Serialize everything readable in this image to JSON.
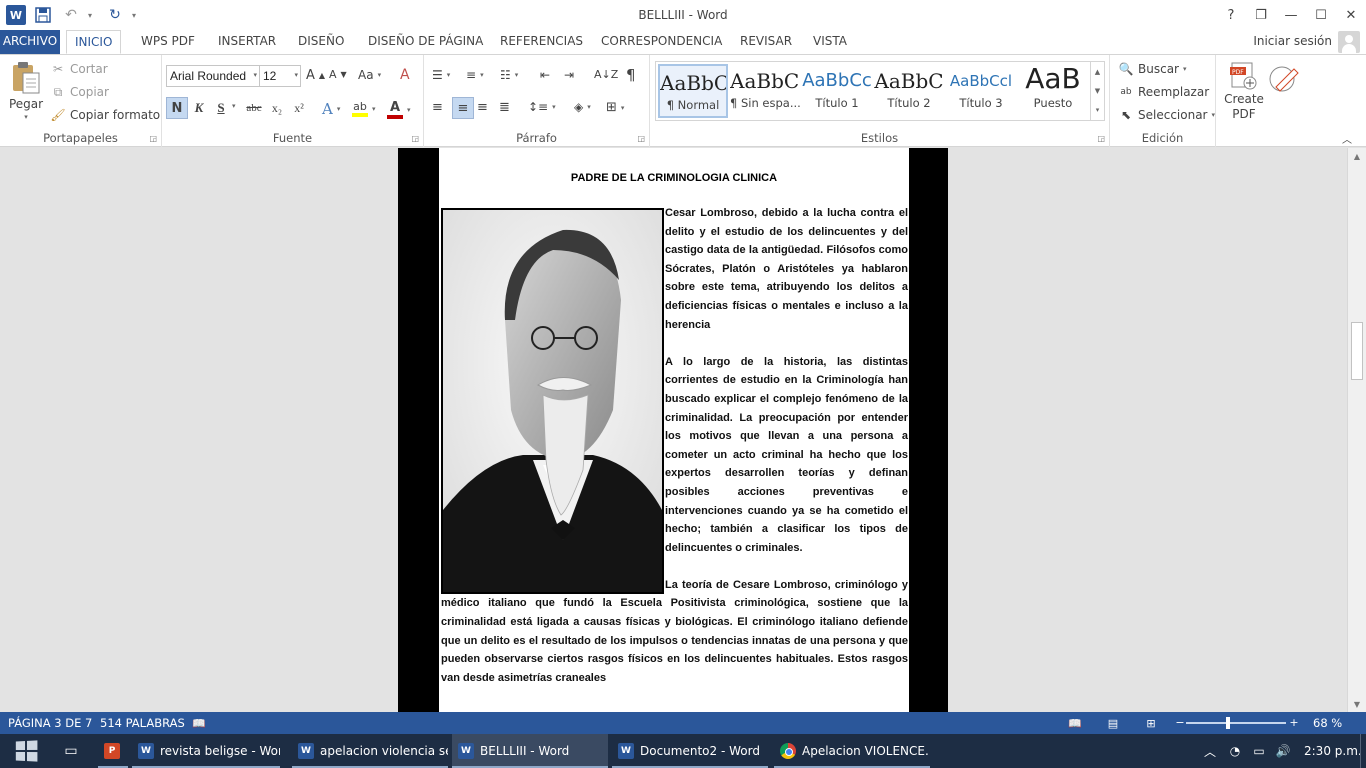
{
  "window": {
    "title": "BELLLIII - Word",
    "controls": [
      "?",
      "❐",
      "—",
      "☐",
      "✕"
    ]
  },
  "tabs": {
    "file": "ARCHIVO",
    "items": [
      "INICIO",
      "WPS PDF",
      "INSERTAR",
      "DISEÑO",
      "DISEÑO DE PÁGINA",
      "REFERENCIAS",
      "CORRESPONDENCIA",
      "REVISAR",
      "VISTA"
    ],
    "active": "INICIO",
    "signin": "Iniciar sesión"
  },
  "clipboard": {
    "paste": "Pegar",
    "cut": "Cortar",
    "copy": "Copiar",
    "format_painter": "Copiar formato",
    "label": "Portapapeles"
  },
  "font": {
    "family": "Arial Rounded",
    "size": "12",
    "bold": "N",
    "italic": "K",
    "underline": "S",
    "strike": "abc",
    "subscript": "x₂",
    "superscript": "x²",
    "label": "Fuente",
    "highlight_color": "#ffff00",
    "font_color": "#c00000"
  },
  "paragraph": {
    "label": "Párrafo"
  },
  "styles": {
    "items": [
      {
        "sample": "AaBbCcDc",
        "name": "¶ Normal"
      },
      {
        "sample": "AaBbCcDc",
        "name": "¶ Sin espa..."
      },
      {
        "sample": "AaBbCc",
        "name": "Título 1"
      },
      {
        "sample": "AaBbC",
        "name": "Título 2"
      },
      {
        "sample": "AaBbCcl",
        "name": "Título 3"
      },
      {
        "sample": "AaB",
        "name": "Puesto"
      }
    ],
    "label": "Estilos"
  },
  "editing": {
    "find": "Buscar",
    "replace": "Reemplazar",
    "select": "Seleccionar",
    "label": "Edición"
  },
  "pdf": {
    "create": "Create",
    "pdf": "PDF"
  },
  "document": {
    "heading": "PADRE DE LA CRIMINOLOGIA CLINICA",
    "paragraphs": [
      "Cesar Lombroso, debido a la lucha contra el delito y el estudio de los delincuentes y del castigo data de la antigüedad. Filósofos como Sócrates, Platón o Aristóteles ya hablaron sobre este tema, atribuyendo los delitos a deficiencias físicas o mentales e incluso a la herencia",
      "A lo largo de la historia, las distintas corrientes de estudio en la Criminología han buscado explicar el complejo fenómeno de la criminalidad. La preocupación por entender los motivos que llevan a una persona a cometer un acto criminal ha hecho que los expertos desarrollen teorías y definan posibles acciones preventivas e intervenciones cuando ya se ha cometido el hecho; también a clasificar los tipos de delincuentes o criminales.",
      "La teoría de Cesare Lombroso, criminólogo y médico italiano que fundó la Escuela Positivista criminológica, sostiene que la criminalidad está ligada a causas físicas y biológicas. El criminólogo italiano defiende que un delito es el resultado de los impulsos o tendencias innatas de una persona y que pueden observarse ciertos rasgos físicos en los delincuentes habituales. Estos rasgos van desde asimetrías craneales"
    ]
  },
  "status": {
    "page": "PÁGINA 3 DE 7",
    "words": "514 PALABRAS",
    "zoom": "68 %",
    "zoom_level": 0.42
  },
  "taskbar": {
    "apps": [
      {
        "icon": "W",
        "label": "revista beligse - Word",
        "active": false
      },
      {
        "icon": "W",
        "label": "apelacion violencia se...",
        "active": false
      },
      {
        "icon": "W",
        "label": "BELLLIII - Word",
        "active": true
      },
      {
        "icon": "W",
        "label": "Documento2 - Word",
        "active": false
      },
      {
        "icon": "C",
        "label": "Apelacion VIOLENCE...",
        "active": false
      }
    ],
    "powerpoint_icon": "P",
    "time": "2:30 p.m."
  }
}
